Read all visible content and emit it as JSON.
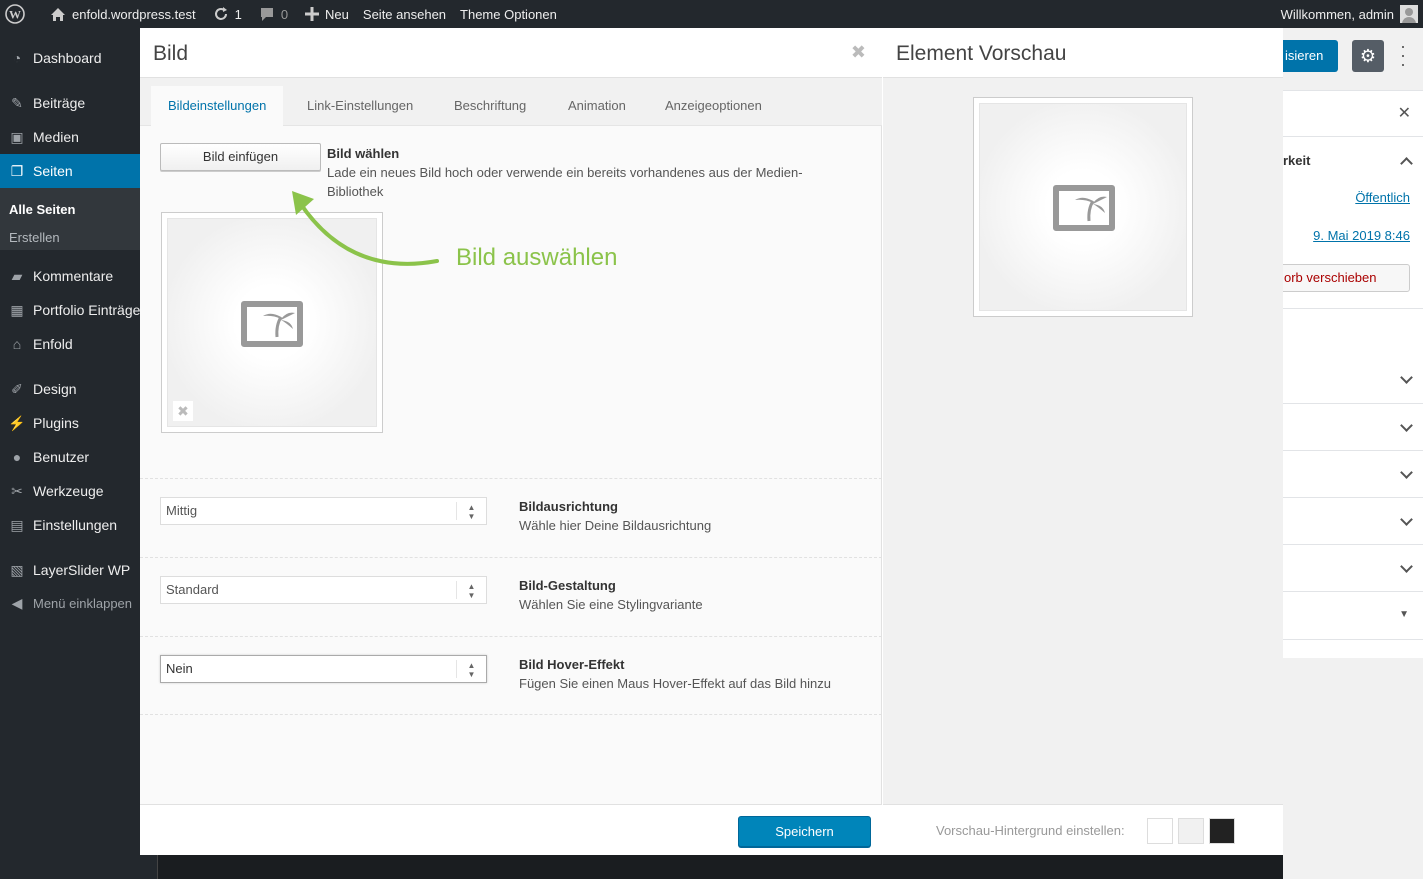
{
  "adminbar": {
    "site": "enfold.wordpress.test",
    "updates": "1",
    "comments": "0",
    "new": "Neu",
    "view": "Seite ansehen",
    "theme": "Theme Optionen",
    "greeting": "Willkommen, admin"
  },
  "sidebar": {
    "items": [
      {
        "label": "Dashboard",
        "icon": "dashboard-icon"
      },
      {
        "label": "Beiträge",
        "icon": "pin-icon"
      },
      {
        "label": "Medien",
        "icon": "media-icon"
      },
      {
        "label": "Seiten",
        "icon": "pages-icon"
      },
      {
        "label": "Kommentare",
        "icon": "comment-icon"
      },
      {
        "label": "Portfolio Einträge",
        "icon": "portfolio-icon"
      },
      {
        "label": "Enfold",
        "icon": "home-icon"
      },
      {
        "label": "Design",
        "icon": "brush-icon"
      },
      {
        "label": "Plugins",
        "icon": "plug-icon"
      },
      {
        "label": "Benutzer",
        "icon": "user-icon"
      },
      {
        "label": "Werkzeuge",
        "icon": "wrench-icon"
      },
      {
        "label": "Einstellungen",
        "icon": "settings-icon"
      },
      {
        "label": "LayerSlider WP",
        "icon": "slider-icon"
      },
      {
        "label": "Menü einklappen",
        "icon": "collapse-icon"
      }
    ],
    "sub": {
      "all": "Alle Seiten",
      "create": "Erstellen"
    }
  },
  "rightpage": {
    "publish_fragment": "isieren",
    "row_label_fragment": "rkeit",
    "public": "Öffentlich",
    "date": "9. Mai 2019 8:46",
    "trash_fragment": "orb verschieben"
  },
  "modal": {
    "title": "Bild",
    "tabs": [
      "Bildeinstellungen",
      "Link-Einstellungen",
      "Beschriftung",
      "Animation",
      "Anzeigeoptionen"
    ],
    "insert_button": "Bild einfügen",
    "choose_title": "Bild wählen",
    "choose_desc": "Lade ein neues Bild hoch oder verwende ein bereits vorhandenes aus der Medien-Bibliothek",
    "options": [
      {
        "value": "Mittig",
        "title": "Bildausrichtung",
        "desc": "Wähle hier Deine Bildausrichtung"
      },
      {
        "value": "Standard",
        "title": "Bild-Gestaltung",
        "desc": "Wählen Sie eine Stylingvariante"
      },
      {
        "value": "Nein",
        "title": "Bild Hover-Effekt",
        "desc": "Fügen Sie einen Maus Hover-Effekt auf das Bild hinzu"
      }
    ],
    "save": "Speichern"
  },
  "preview": {
    "title": "Element Vorschau",
    "bg_label": "Vorschau-Hintergrund einstellen:",
    "swatches": [
      "#ffffff",
      "#f1f1f1",
      "#222222"
    ]
  },
  "annotation": "Bild auswählen",
  "colors": {
    "accent": "#0073aa",
    "annotation": "#8bc34a"
  }
}
